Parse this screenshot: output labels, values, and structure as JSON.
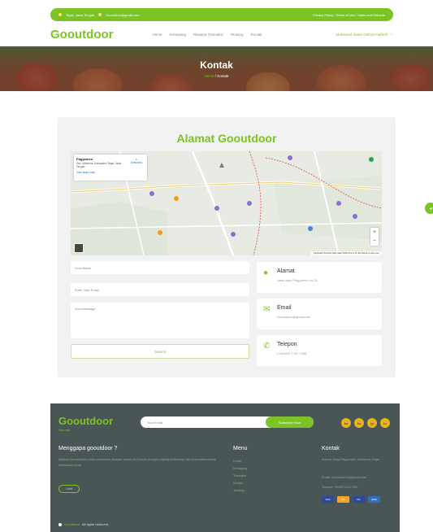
{
  "topbar": {
    "location": "Tegal, Jawa Tengah",
    "email": "Gooutdoor@gmail.com",
    "policy": "Privacy Policy / Terms of Use / Sales and Refunds"
  },
  "header": {
    "brand": "Gooutdoor",
    "nav": [
      "Home",
      "Keranjang",
      "Riwayat Transaksi",
      "Tentang",
      "Kontak"
    ],
    "user": "Muhamad Abdul Gufron Fakhrih"
  },
  "hero": {
    "title": "Kontak",
    "crumb_home": "Home",
    "crumb_sep": "/",
    "crumb_current": "Kontak"
  },
  "contact": {
    "title": "Alamat Gooutdoor",
    "map": {
      "place_name": "Pagyanten",
      "place_address": "Kec. Adiwerna, Kabupaten Tegal, Jawa Tengah",
      "larger_map": "View larger map",
      "directions": "Directions",
      "attribution": "Keyboard shortcuts  Map data ©2022  Terms of Use  Report a map error"
    },
    "form": {
      "name_placeholder": "Your Name",
      "email_placeholder": "Enter Your Email",
      "message_placeholder": "Your Message",
      "submit_label": "Submit"
    },
    "info": [
      {
        "icon": "map-pin-icon",
        "title": "Alamat",
        "value": "Jalan raya Pagyanten no.31"
      },
      {
        "icon": "envelope-icon",
        "title": "Email",
        "value": "Gooutdoor@gmail.com"
      },
      {
        "icon": "phone-icon",
        "title": "Telepon",
        "value": "(+62)822 7737 7355"
      }
    ]
  },
  "footer": {
    "brand": "Gooutdoor",
    "tagline": "Gear talk",
    "email_placeholder": "Your Email",
    "subscribe_label": "Subscribe Now",
    "socials": [
      "tw",
      "fb",
      "yt",
      "in"
    ],
    "why_title": "Menggapa gooutdoor ?",
    "why_text": "Aplikasi Marketplace untuk memenuhi akuntan antara di Outdoor dengan cepang berbelanja dan berkualitas sesuai Kebutuhan Anda",
    "why_button": "Lihat",
    "menu_title": "Menu",
    "menu_items": [
      "Home",
      "Keranjang",
      "Transaksi",
      "Kontak",
      "Tentang"
    ],
    "contact_title": "Kontak",
    "contact_lines": [
      "Alamat: Desa Pagyanten, Adiwerna, Tegal",
      "Email: Gooutdoor24@gmail.com",
      "Telepon: +6285721117326"
    ],
    "payments": [
      "VISA",
      "MC",
      "MC",
      "AMEX"
    ],
    "copyright_brand": "Gooutdoor",
    "copyright_text": "All rights reserved."
  },
  "colors": {
    "accent": "#7cc425",
    "footer_bg": "#4a5655",
    "card_bg": "#f1f2f1"
  }
}
